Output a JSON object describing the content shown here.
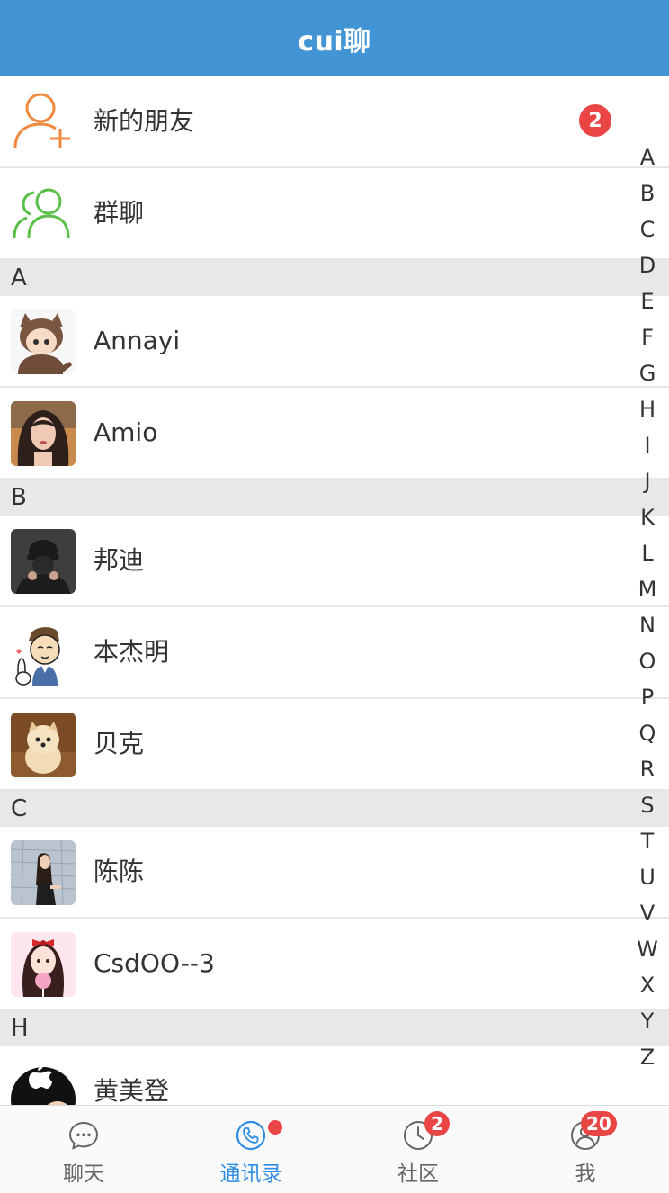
{
  "header": {
    "title": "cui聊"
  },
  "top_entries": [
    {
      "label": "新的朋友",
      "icon": "add-friend-icon",
      "badge": "2"
    },
    {
      "label": "群聊",
      "icon": "group-chat-icon"
    }
  ],
  "sections": [
    {
      "letter": "A",
      "contacts": [
        {
          "name": "Annayi"
        },
        {
          "name": "Amio"
        }
      ]
    },
    {
      "letter": "B",
      "contacts": [
        {
          "name": "邦迪"
        },
        {
          "name": "本杰明"
        },
        {
          "name": "贝克"
        }
      ]
    },
    {
      "letter": "C",
      "contacts": [
        {
          "name": "陈陈"
        },
        {
          "name": "CsdOO--3"
        }
      ]
    },
    {
      "letter": "H",
      "contacts": [
        {
          "name": "黄美登"
        }
      ]
    }
  ],
  "index_letters": [
    "A",
    "B",
    "C",
    "D",
    "E",
    "F",
    "G",
    "H",
    "I",
    "J",
    "K",
    "L",
    "M",
    "N",
    "O",
    "P",
    "Q",
    "R",
    "S",
    "T",
    "U",
    "V",
    "W",
    "X",
    "Y",
    "Z"
  ],
  "tabs": [
    {
      "label": "聊天",
      "icon": "chat-bubble-icon",
      "active": false
    },
    {
      "label": "通讯录",
      "icon": "phone-icon",
      "active": true,
      "dot": true
    },
    {
      "label": "社区",
      "icon": "clock-icon",
      "active": false,
      "badge": "2"
    },
    {
      "label": "我",
      "icon": "profile-icon",
      "active": false,
      "badge": "20"
    }
  ],
  "colors": {
    "header": "#4294d5",
    "accent": "#2f8de4",
    "badge": "#e94545",
    "add_friend_icon": "#f0883e",
    "group_icon": "#5cbf4a"
  }
}
